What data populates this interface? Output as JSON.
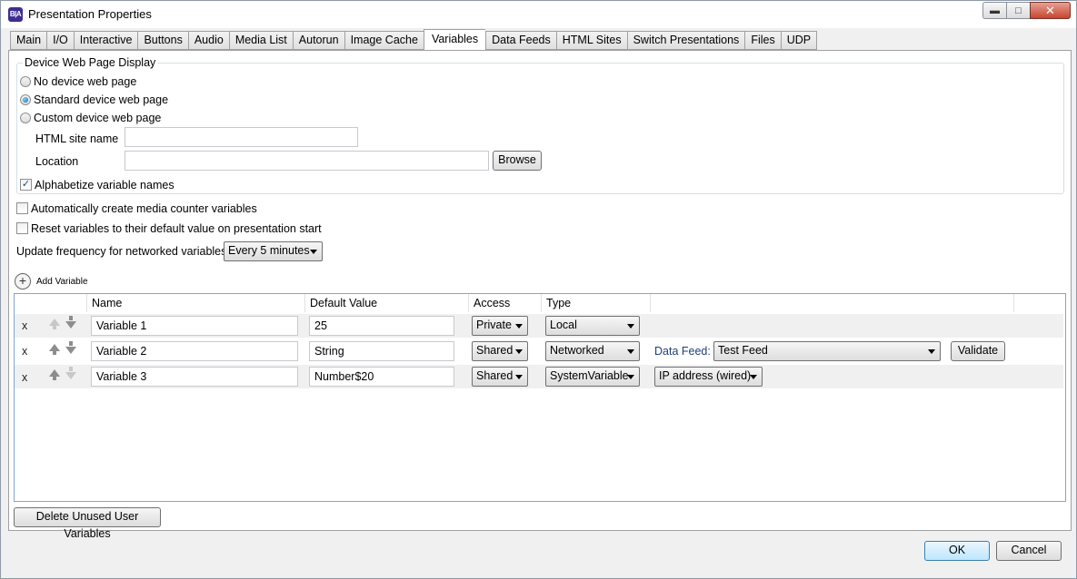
{
  "window": {
    "title": "Presentation Properties",
    "app_icon_text": "B|A"
  },
  "tabs": [
    "Main",
    "I/O",
    "Interactive",
    "Buttons",
    "Audio",
    "Media List",
    "Autorun",
    "Image Cache",
    "Variables",
    "Data Feeds",
    "HTML Sites",
    "Switch Presentations",
    "Files",
    "UDP"
  ],
  "active_tab": "Variables",
  "device_web_page": {
    "group_title": "Device Web Page Display",
    "options": [
      "No device web page",
      "Standard device web page",
      "Custom device web page"
    ],
    "selected": "Standard device web page",
    "html_site_name_label": "HTML site name",
    "html_site_name_value": "",
    "location_label": "Location",
    "location_value": "",
    "browse_label": "Browse",
    "alphabetize_label": "Alphabetize variable names",
    "alphabetize_checked": true
  },
  "options": {
    "auto_counter_label": "Automatically create media counter variables",
    "auto_counter_checked": false,
    "reset_label": "Reset variables to their default value on presentation start",
    "reset_checked": false,
    "update_freq_label": "Update frequency for networked variables:",
    "update_freq_value": "Every 5 minutes"
  },
  "add_variable_label": "Add Variable",
  "grid": {
    "headers": {
      "name": "Name",
      "default": "Default Value",
      "access": "Access",
      "type": "Type"
    },
    "rows": [
      {
        "delete": "x",
        "name": "Variable 1",
        "default": "25",
        "access": "Private",
        "type": "Local"
      },
      {
        "delete": "x",
        "name": "Variable 2",
        "default": "String",
        "access": "Shared",
        "type": "Networked",
        "data_feed_label": "Data Feed:",
        "data_feed_value": "Test Feed",
        "validate_label": "Validate"
      },
      {
        "delete": "x",
        "name": "Variable 3",
        "default": "Number$20",
        "access": "Shared",
        "type": "SystemVariable",
        "system_value": "IP address (wired)"
      }
    ]
  },
  "delete_unused_label": "Delete Unused User Variables",
  "ok_label": "OK",
  "cancel_label": "Cancel"
}
